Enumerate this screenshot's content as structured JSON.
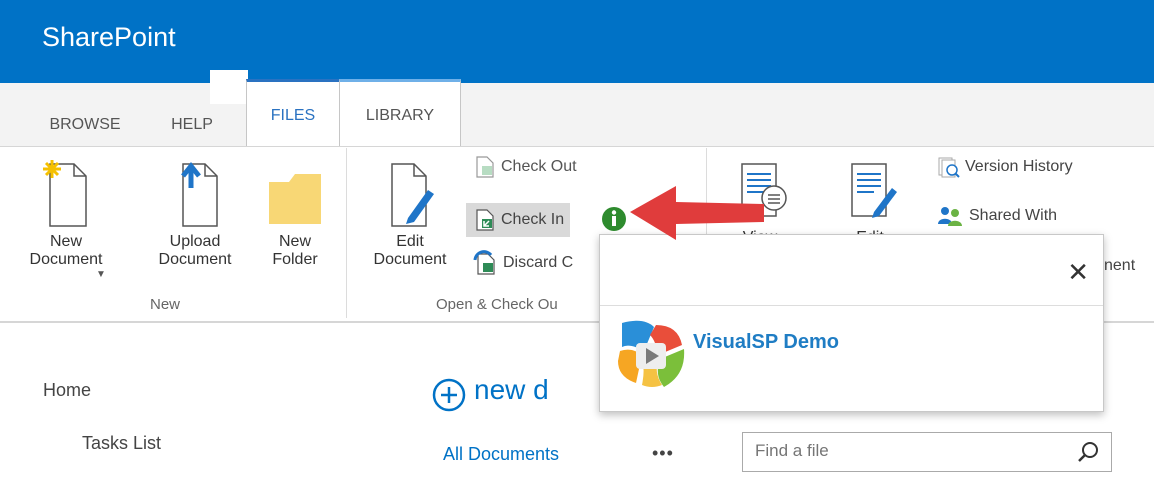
{
  "suite": {
    "brand": "SharePoint"
  },
  "tabs": [
    {
      "label": "BROWSE"
    },
    {
      "label": "HELP"
    },
    {
      "label": "FILES"
    },
    {
      "label": "LIBRARY"
    }
  ],
  "ribbon": {
    "new_group": {
      "label": "New",
      "new_document": "New\nDocument",
      "upload_document": "Upload\nDocument",
      "new_folder": "New\nFolder"
    },
    "open_group": {
      "label": "Open & Check Ou",
      "edit_document": "Edit\nDocument",
      "check_out": "Check Out",
      "check_in": "Check In",
      "discard": "Discard C"
    },
    "manage_group": {
      "view_partial": "View",
      "edit_partial": "Edit",
      "version_history": "Version History",
      "shared_with": "Shared With",
      "ment_partial": "nent"
    }
  },
  "nav": {
    "home": "Home",
    "tasks_list": "Tasks List"
  },
  "main": {
    "new_document": "new d",
    "all_documents": "All Documents",
    "more": "•••",
    "search_placeholder": "Find a file"
  },
  "callout": {
    "title": "VisualSP Demo",
    "close_glyph": "✕"
  },
  "colors": {
    "suite_blue": "#0072c6",
    "accent_red": "#e03c3c",
    "info_green": "#2e8b2e"
  }
}
